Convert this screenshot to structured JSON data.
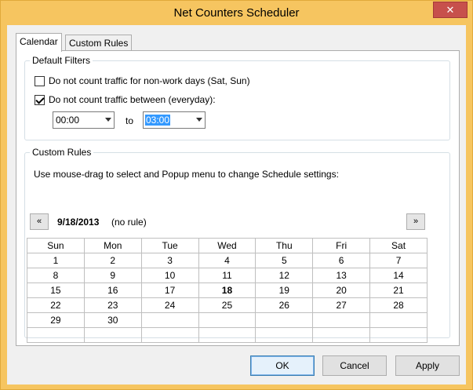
{
  "window": {
    "title": "Net Counters Scheduler",
    "close_glyph": "✕"
  },
  "tabs": [
    {
      "label": "Calendar",
      "active": true
    },
    {
      "label": "Custom Rules",
      "active": false
    }
  ],
  "default_filters": {
    "legend": "Default Filters",
    "non_work_days": {
      "label": "Do not count traffic for non-work days (Sat, Sun)",
      "checked": false
    },
    "between": {
      "label": "Do not count traffic between (everyday):",
      "checked": true
    },
    "from_time": "00:00",
    "to_label": "to",
    "to_time": "03:00"
  },
  "custom_rules": {
    "legend": "Custom Rules",
    "instructions": "Use mouse-drag to select and Popup menu to change Schedule settings:",
    "prev_label": "«",
    "next_label": "»",
    "current_date": "9/18/2013",
    "rule_status": "(no rule)"
  },
  "calendar": {
    "headers": [
      "Sun",
      "Mon",
      "Tue",
      "Wed",
      "Thu",
      "Fri",
      "Sat"
    ],
    "weeks": [
      [
        "1",
        "2",
        "3",
        "4",
        "5",
        "6",
        "7"
      ],
      [
        "8",
        "9",
        "10",
        "11",
        "12",
        "13",
        "14"
      ],
      [
        "15",
        "16",
        "17",
        "18",
        "19",
        "20",
        "21"
      ],
      [
        "22",
        "23",
        "24",
        "25",
        "26",
        "27",
        "28"
      ],
      [
        "29",
        "30",
        "",
        "",
        "",
        "",
        ""
      ],
      [
        "",
        "",
        "",
        "",
        "",
        "",
        ""
      ]
    ],
    "today": "18"
  },
  "buttons": {
    "ok": "OK",
    "cancel": "Cancel",
    "apply": "Apply"
  },
  "colors": {
    "title_bar": "#f6c560",
    "close_button": "#c7504c",
    "selection": "#3399ff"
  }
}
